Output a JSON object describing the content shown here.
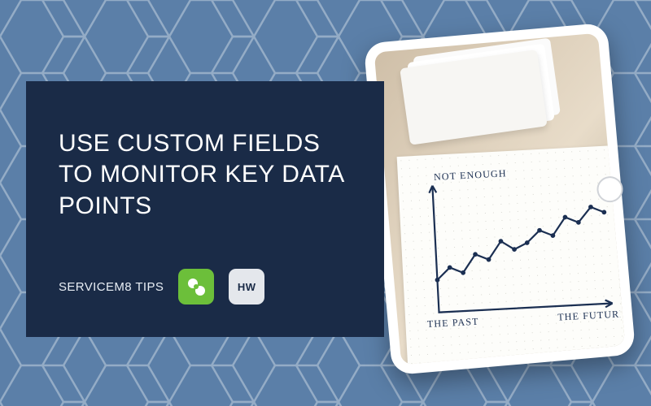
{
  "brand_colors": {
    "panel_bg": "#1a2b47",
    "canvas_bg": "#5b7fa8",
    "accent_green": "#6cbf3a"
  },
  "headline": "USE CUSTOM FIELDS TO MONITOR KEY DATA POINTS",
  "subtitle": "SERVICEM8 TIPS",
  "logos": {
    "servicem8": {
      "name": "servicem8-logo"
    },
    "hw": {
      "name": "hw-logo",
      "text": "HW"
    }
  },
  "chart_data": {
    "type": "line",
    "title": "",
    "xlabel": "THE PAST → THE FUTURE",
    "ylabel": "NOT ENOUGH",
    "x": [
      0,
      1,
      2,
      3,
      4,
      5,
      6,
      7,
      8,
      9,
      10,
      11,
      12,
      13
    ],
    "values": [
      22,
      30,
      26,
      38,
      34,
      46,
      40,
      44,
      52,
      48,
      60,
      56,
      66,
      62
    ],
    "ylim": [
      0,
      80
    ],
    "axis_labels": {
      "y_top": "NOT ENOUGH",
      "x_left": "THE PAST",
      "x_right": "THE FUTURE"
    }
  }
}
